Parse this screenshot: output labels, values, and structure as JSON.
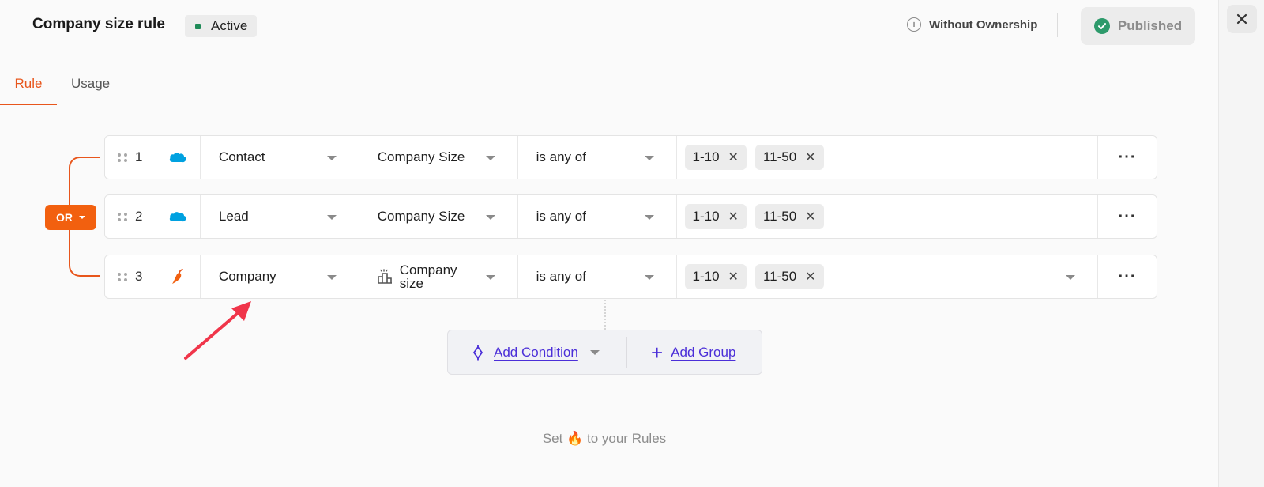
{
  "header": {
    "title": "Company size rule",
    "status": "Active",
    "ownership_label": "Without Ownership",
    "published_label": "Published"
  },
  "tabs": [
    {
      "label": "Rule",
      "active": true
    },
    {
      "label": "Usage",
      "active": false
    }
  ],
  "group_operator": "OR",
  "conditions": [
    {
      "num": "1",
      "source_icon": "salesforce-cloud-icon",
      "object": "Contact",
      "field": "Company Size",
      "operator": "is any of",
      "values": [
        "1-10",
        "11-50"
      ]
    },
    {
      "num": "2",
      "source_icon": "salesforce-cloud-icon",
      "object": "Lead",
      "field": "Company Size",
      "operator": "is any of",
      "values": [
        "1-10",
        "11-50"
      ]
    },
    {
      "num": "3",
      "source_icon": "chili-pepper-icon",
      "object": "Company",
      "field_line1": "Company",
      "field_line2": "size",
      "operator": "is any of",
      "values": [
        "1-10",
        "11-50"
      ]
    }
  ],
  "actions": {
    "add_condition": "Add Condition",
    "add_group": "Add Group"
  },
  "footer": {
    "before": "Set",
    "emoji": "🔥",
    "after": "to your Rules"
  },
  "colors": {
    "accent": "#e8561c",
    "status_green": "#1e8a57",
    "link_purple": "#4b2fd8",
    "salesforce_blue": "#00a1e0"
  }
}
